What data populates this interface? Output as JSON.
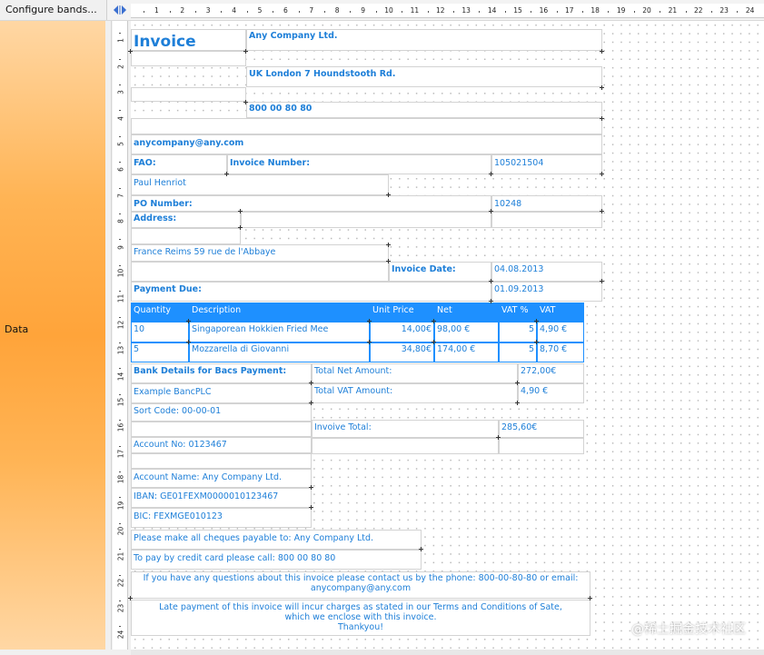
{
  "toolbar": {
    "configure_bands_label": "Configure bands...",
    "band_label": "Data"
  },
  "ruler": {
    "h_ticks": [
      "1",
      "2",
      "3",
      "4",
      "5",
      "6",
      "7",
      "8",
      "9",
      "10",
      "11",
      "12",
      "13",
      "14",
      "15",
      "16",
      "17",
      "18",
      "19",
      "20",
      "21",
      "22",
      "23",
      "24"
    ],
    "v_ticks": [
      "1",
      "2",
      "3",
      "4",
      "5",
      "6",
      "7",
      "8",
      "9",
      "10",
      "11",
      "12",
      "13",
      "14",
      "15",
      "16",
      "17",
      "18",
      "19",
      "20",
      "21",
      "22",
      "23",
      "24"
    ]
  },
  "invoice": {
    "title": "Invoice",
    "company_name": "Any Company Ltd.",
    "company_address": "UK London 7 Houndstooth Rd.",
    "company_phone": "800 00 80 80",
    "company_email": "anycompany@any.com",
    "fao_label": "FAO:",
    "invoice_number_label": "Invoice Number:",
    "invoice_number": "105021504",
    "fao_name": "Paul Henriot",
    "po_number_label": "PO Number:",
    "po_number": "10248",
    "address_label": "Address:",
    "address": "France Reims 59 rue de l'Abbaye",
    "invoice_date_label": "Invoice Date:",
    "invoice_date": "04.08.2013",
    "payment_due_label": "Payment Due:",
    "payment_due": "01.09.2013"
  },
  "table": {
    "headers": [
      "Quantity",
      "Description",
      "Unit Price",
      "Net",
      "VAT %",
      "VAT"
    ],
    "rows": [
      [
        "10",
        "Singaporean Hokkien Fried Mee",
        "14,00€",
        "98,00 €",
        "5",
        "4,90 €"
      ],
      [
        "5",
        "Mozzarella di Giovanni",
        "34,80€",
        "174,00 €",
        "5",
        "8,70 €"
      ]
    ]
  },
  "bank": {
    "title": "Bank Details for Bacs Payment:",
    "bank_name": "Example BancPLC",
    "sort_code": "Sort Code: 00-00-01",
    "account_no": "Account No: 0123467",
    "account_name": "Account Name: Any Company Ltd.",
    "iban": "IBAN: GE01FEXM0000010123467",
    "bic": "BIC: FEXMGE010123"
  },
  "totals": {
    "net_label": "Total Net Amount:",
    "net_value": "272,00€",
    "vat_label": "Total VAT Amount:",
    "vat_value": "4,90 €",
    "invoice_total_label": "Invoive Total:",
    "invoice_total_value": "285,60€"
  },
  "footer": {
    "cheques": "Please make all cheques payable to: Any Company Ltd.",
    "credit_card": "To pay by credit card please call: 800 00 80 80",
    "questions_line1": "If you have any questions about this invoice please contact us by the phone: 800-00-80-80 or email:",
    "questions_line2": "anycompany@any.com",
    "late_line1": "Late payment of this invoice will incur charges as stated in our Terms and Conditions of Sate,",
    "late_line2": "which we enclose with this invoice.",
    "late_line3": "Thankyou!"
  },
  "watermark": "@稀土掘金技术社区"
}
